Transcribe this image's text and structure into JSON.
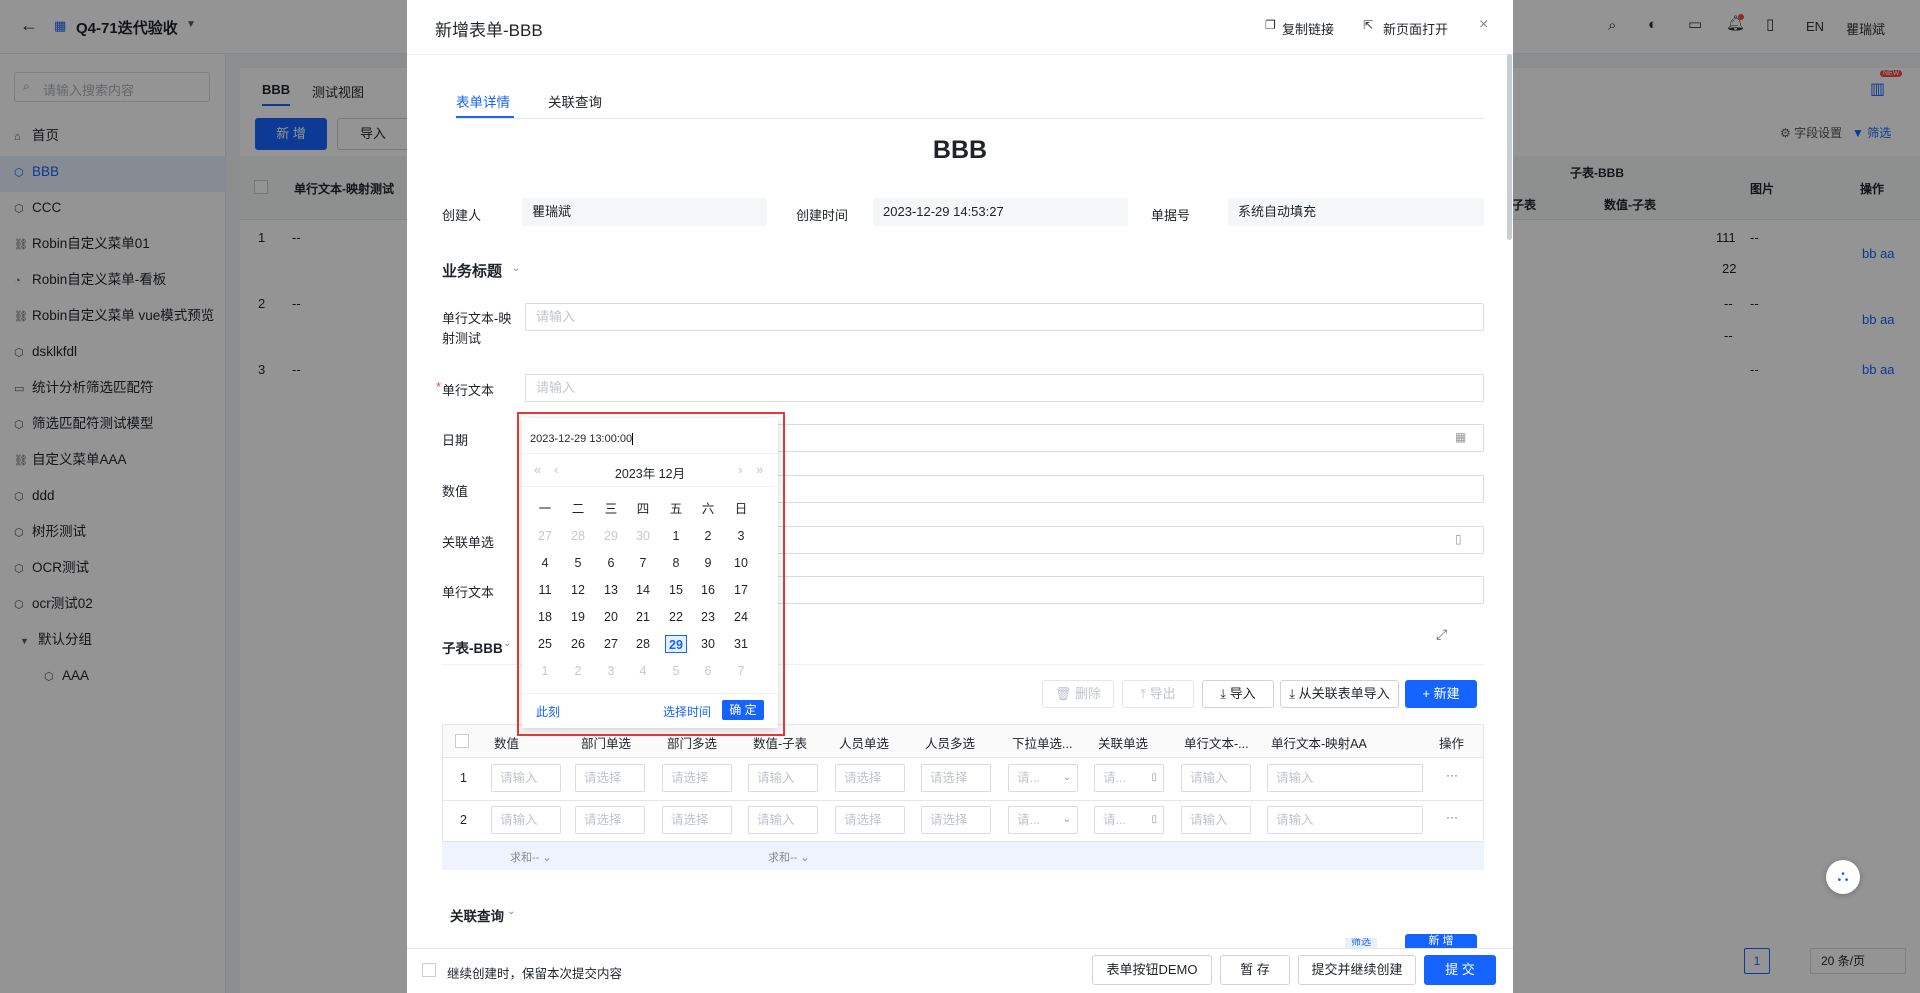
{
  "app": {
    "title": "Q4-71迭代验收",
    "lang": "EN",
    "user": "瞿瑞斌"
  },
  "sidebar": {
    "search_placeholder": "请输入搜索内容",
    "items": [
      {
        "label": "首页"
      },
      {
        "label": "BBB"
      },
      {
        "label": "CCC"
      },
      {
        "label": "Robin自定义菜单01"
      },
      {
        "label": "Robin自定义菜单-看板"
      },
      {
        "label": "Robin自定义菜单 vue模式预览"
      },
      {
        "label": "dsklkfdl"
      },
      {
        "label": "统计分析筛选匹配符"
      },
      {
        "label": "筛选匹配符测试模型"
      },
      {
        "label": "自定义菜单AAA"
      },
      {
        "label": "ddd"
      },
      {
        "label": "树形测试"
      },
      {
        "label": "OCR测试"
      },
      {
        "label": "ocr测试02"
      },
      {
        "label": "默认分组"
      },
      {
        "label": "AAA"
      }
    ]
  },
  "background": {
    "tabs": [
      "BBB",
      "测试视图"
    ],
    "add_label": "新 增",
    "import_label": "导入",
    "col_text": "单行文本-映射测试",
    "col_sub": "子表-BBB",
    "col_sub_a": "-子表",
    "col_sub_b": "数值-子表",
    "col_image": "图片",
    "col_action": "操作",
    "field_settings": "字段设置",
    "filter": "筛选",
    "new_badge": "NEW",
    "rows": [
      {
        "no": "1",
        "text": "--",
        "v1": "111",
        "v2": "22",
        "img": "--",
        "act": "bb aa"
      },
      {
        "no": "2",
        "text": "--",
        "v1": "--",
        "v2": "--",
        "img": "--",
        "act": "bb aa"
      },
      {
        "no": "3",
        "text": "--",
        "img": "--",
        "act": "bb aa"
      }
    ],
    "pagination": {
      "page": "1",
      "size": "20 条/页"
    }
  },
  "modal": {
    "title": "新增表单-BBB",
    "copy_link": "复制链接",
    "open_new": "新页面打开",
    "tabs": [
      "表单详情",
      "关联查询"
    ],
    "form_title": "BBB",
    "creator_label": "创建人",
    "creator": "瞿瑞斌",
    "created_label": "创建时间",
    "created": "2023-12-29 14:53:27",
    "docno_label": "单据号",
    "docno": "系统自动填充",
    "section_title": "业务标题",
    "fields": {
      "map_text_label": "单行文本-映射测试",
      "map_text_placeholder": "请输入",
      "text_label": "单行文本",
      "text_placeholder": "请输入",
      "date_label": "日期",
      "number_label": "数值",
      "relation_label": "关联单选",
      "text2_label": "单行文本"
    },
    "subtable": {
      "title": "子表-BBB",
      "btn_delete": "删除",
      "btn_export": "导出",
      "btn_import": "导入",
      "btn_import_rel": "从关联表单导入",
      "btn_new": "新建",
      "columns": [
        "数值",
        "部门单选",
        "部门多选",
        "数值-子表",
        "人员单选",
        "人员多选",
        "下拉单选...",
        "关联单选",
        "单行文本-...",
        "单行文本-映射AA",
        "操作"
      ],
      "rows": [
        {
          "no": "1",
          "cells": [
            "请输入",
            "请选择",
            "请选择",
            "请输入",
            "请选择",
            "请选择",
            "请...",
            "请...",
            "请输入",
            "请输入"
          ]
        },
        {
          "no": "2",
          "cells": [
            "请输入",
            "请选择",
            "请选择",
            "请输入",
            "请选择",
            "请选择",
            "请...",
            "请...",
            "请输入",
            "请输入"
          ]
        }
      ],
      "sum_labels": [
        "求和--",
        "求和--"
      ],
      "row_more": "···"
    },
    "related_title": "关联查询",
    "footer": {
      "keep_label": "继续创建时，保留本次提交内容",
      "demo_btn": "表单按钮DEMO",
      "save_btn": "暂 存",
      "submit_continue_btn": "提交并继续创建",
      "submit_btn": "提 交"
    },
    "filter_chip": "筛选",
    "new_btn_partial": "新 增"
  },
  "datepicker": {
    "value": "2023-12-29 13:00:00",
    "header": "2023年 12月",
    "weekdays": [
      "一",
      "二",
      "三",
      "四",
      "五",
      "六",
      "日"
    ],
    "weeks": [
      [
        "27",
        "28",
        "29",
        "30",
        "1",
        "2",
        "3"
      ],
      [
        "4",
        "5",
        "6",
        "7",
        "8",
        "9",
        "10"
      ],
      [
        "11",
        "12",
        "13",
        "14",
        "15",
        "16",
        "17"
      ],
      [
        "18",
        "19",
        "20",
        "21",
        "22",
        "23",
        "24"
      ],
      [
        "25",
        "26",
        "27",
        "28",
        "29",
        "30",
        "31"
      ],
      [
        "1",
        "2",
        "3",
        "4",
        "5",
        "6",
        "7"
      ]
    ],
    "selected_day": "29",
    "now_label": "此刻",
    "select_time_label": "选择时间",
    "confirm_label": "确 定"
  },
  "colors": {
    "primary": "#1664ff",
    "highlight_border": "#e53935"
  }
}
